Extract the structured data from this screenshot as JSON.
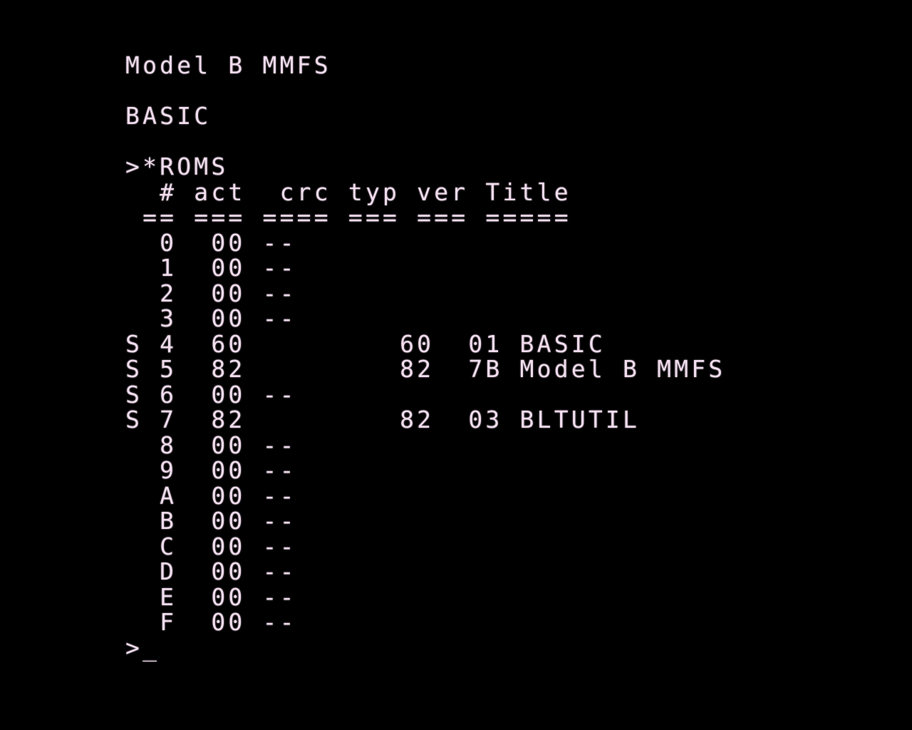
{
  "screen": {
    "foreground_color": "#f3dff0",
    "background_color": "#000000",
    "banner": "Model B MMFS",
    "language": "BASIC",
    "command": ">*ROMS",
    "table_header": "  # act  crc typ ver Title",
    "table_rule": " == === ==== === === =====",
    "rows": [
      "  0  00 --",
      "  1  00 --",
      "  2  00 --",
      "  3  00 --",
      "S 4  60         60  01 BASIC",
      "S 5  82         82  7B Model B MMFS",
      "S 6  00 --",
      "S 7  82         82  03 BLTUTIL",
      "  8  00 --",
      "  9  00 --",
      "  A  00 --",
      "  B  00 --",
      "  C  00 --",
      "  D  00 --",
      "  E  00 --",
      "  F  00 --"
    ],
    "prompt": ">",
    "cursor": "_"
  }
}
